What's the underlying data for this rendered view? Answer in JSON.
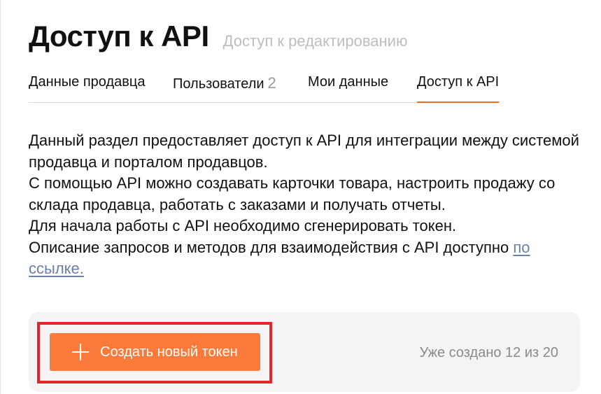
{
  "header": {
    "title": "Доступ к API",
    "subtitle": "Доступ к редактированию"
  },
  "tabs": [
    {
      "label": "Данные продавца",
      "count": "",
      "active": false
    },
    {
      "label": "Пользователи",
      "count": "2",
      "active": false
    },
    {
      "label": "Мои данные",
      "count": "",
      "active": false
    },
    {
      "label": "Доступ к API",
      "count": "",
      "active": true
    }
  ],
  "description": {
    "line1": "Данный раздел предоставляет доступ к API для интеграции между системой продавца и порталом продавцов.",
    "line2": "С помощью API можно создавать карточки товара, настроить продажу со склада продавца, работать с заказами и получать отчеты.",
    "line3": "Для начала работы с API необходимо сгенерировать токен.",
    "line4_text": "Описание запросов и методов для взаимодействия с API доступно ",
    "line4_link": "по ссылке."
  },
  "token_panel": {
    "create_button_label": "Создать новый токен",
    "created_info": "Уже создано 12 из 20"
  },
  "colors": {
    "accent": "#f97a3a",
    "tab_underline": "#f26b21",
    "highlight": "#e5252c",
    "link": "#6b7fa8",
    "panel_bg": "#f4f4f6"
  },
  "icons": {
    "create_button_icon": "plus-icon"
  }
}
